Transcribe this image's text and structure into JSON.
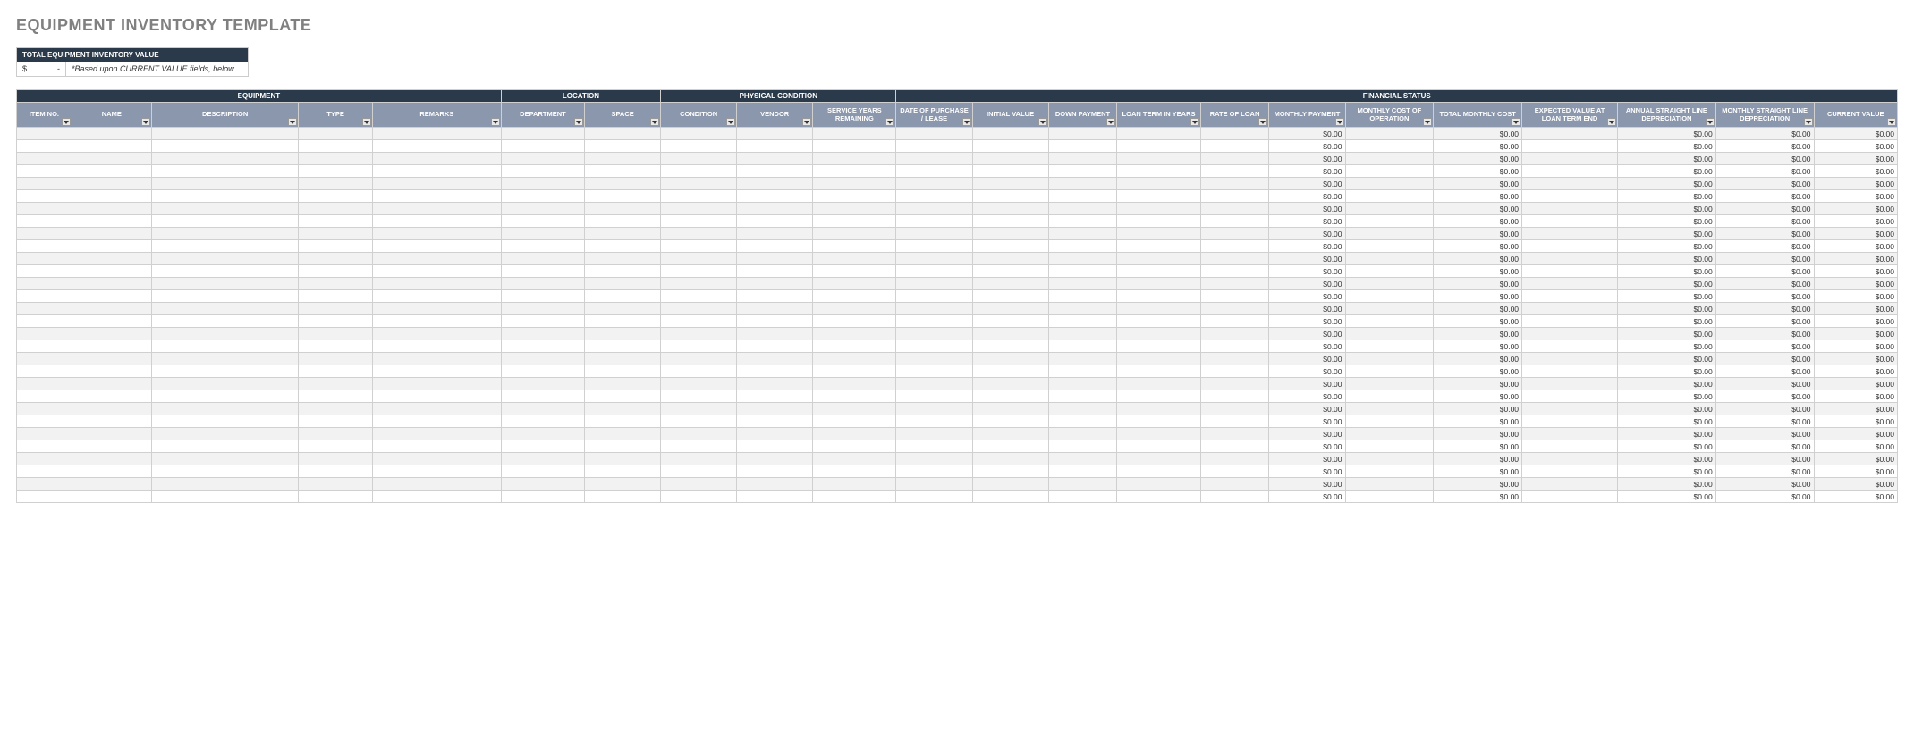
{
  "title": "EQUIPMENT INVENTORY TEMPLATE",
  "summary": {
    "header": "TOTAL EQUIPMENT INVENTORY VALUE",
    "currency": "$",
    "amount": "-",
    "note": "*Based upon CURRENT VALUE fields, below."
  },
  "groups": [
    {
      "label": "EQUIPMENT",
      "span": 5
    },
    {
      "label": "LOCATION",
      "span": 2
    },
    {
      "label": "PHYSICAL CONDITION",
      "span": 3
    },
    {
      "label": "FINANCIAL STATUS",
      "span": 12
    }
  ],
  "columns": [
    {
      "key": "itemno",
      "label": "ITEM NO."
    },
    {
      "key": "name",
      "label": "NAME"
    },
    {
      "key": "desc",
      "label": "DESCRIPTION"
    },
    {
      "key": "type",
      "label": "TYPE"
    },
    {
      "key": "remarks",
      "label": "REMARKS"
    },
    {
      "key": "dept",
      "label": "DEPARTMENT"
    },
    {
      "key": "space",
      "label": "SPACE"
    },
    {
      "key": "cond",
      "label": "CONDITION"
    },
    {
      "key": "vendor",
      "label": "VENDOR"
    },
    {
      "key": "svc",
      "label": "SERVICE YEARS REMAINING"
    },
    {
      "key": "date",
      "label": "DATE OF PURCHASE / LEASE"
    },
    {
      "key": "init",
      "label": "INITIAL VALUE"
    },
    {
      "key": "down",
      "label": "DOWN PAYMENT"
    },
    {
      "key": "loanterm",
      "label": "LOAN TERM IN YEARS"
    },
    {
      "key": "rate",
      "label": "RATE OF LOAN"
    },
    {
      "key": "mpay",
      "label": "MONTHLY PAYMENT"
    },
    {
      "key": "mcost",
      "label": "MONTHLY COST OF OPERATION"
    },
    {
      "key": "tmcost",
      "label": "TOTAL MONTHLY COST"
    },
    {
      "key": "expv",
      "label": "EXPECTED VALUE AT LOAN TERM END"
    },
    {
      "key": "adep",
      "label": "ANNUAL STRAIGHT LINE DEPRECIATION"
    },
    {
      "key": "mdep",
      "label": "MONTHLY STRAIGHT LINE DEPRECIATION"
    },
    {
      "key": "curr",
      "label": "CURRENT VALUE"
    }
  ],
  "calc_columns": [
    "mpay",
    "tmcost",
    "adep",
    "mdep",
    "curr"
  ],
  "zero_value": "$0.00",
  "row_count": 30
}
